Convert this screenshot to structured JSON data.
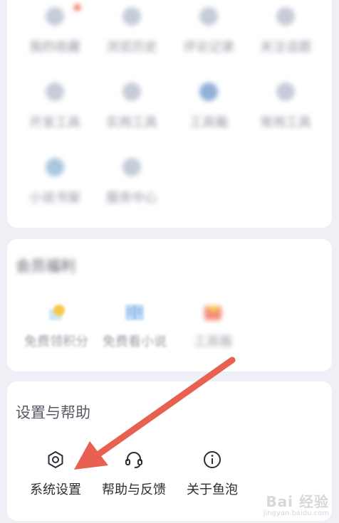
{
  "top_grid": {
    "rows": [
      [
        {
          "label": "我的收藏",
          "badge": true
        },
        {
          "label": "浏览历史",
          "badge": false
        },
        {
          "label": "评论记录",
          "badge": false
        },
        {
          "label": "关注话题",
          "badge": false
        }
      ],
      [
        {
          "label": "开发工具",
          "badge": false
        },
        {
          "label": "实用工具",
          "badge": false
        },
        {
          "label": "工具箱",
          "badge": false
        },
        {
          "label": "常用工具",
          "badge": false
        }
      ],
      [
        {
          "label": "小说书架",
          "badge": false
        },
        {
          "label": "服务中心",
          "badge": false
        }
      ]
    ]
  },
  "member_section": {
    "title": "会员福利",
    "items": [
      {
        "label": "免费领积分",
        "icon": "gift-icon"
      },
      {
        "label": "免费看小说",
        "icon": "book-icon"
      },
      {
        "label": "工具箱",
        "icon": "toolbox-icon"
      }
    ]
  },
  "settings_section": {
    "title": "设置与帮助",
    "items": [
      {
        "label": "系统设置",
        "icon": "settings-icon"
      },
      {
        "label": "帮助与反馈",
        "icon": "headset-icon"
      },
      {
        "label": "关于鱼泡",
        "icon": "info-icon"
      }
    ]
  },
  "annotation": {
    "color": "#e8604f"
  },
  "watermark": {
    "main": "Bai 经验",
    "sub": "jingyan.baidu.com"
  }
}
